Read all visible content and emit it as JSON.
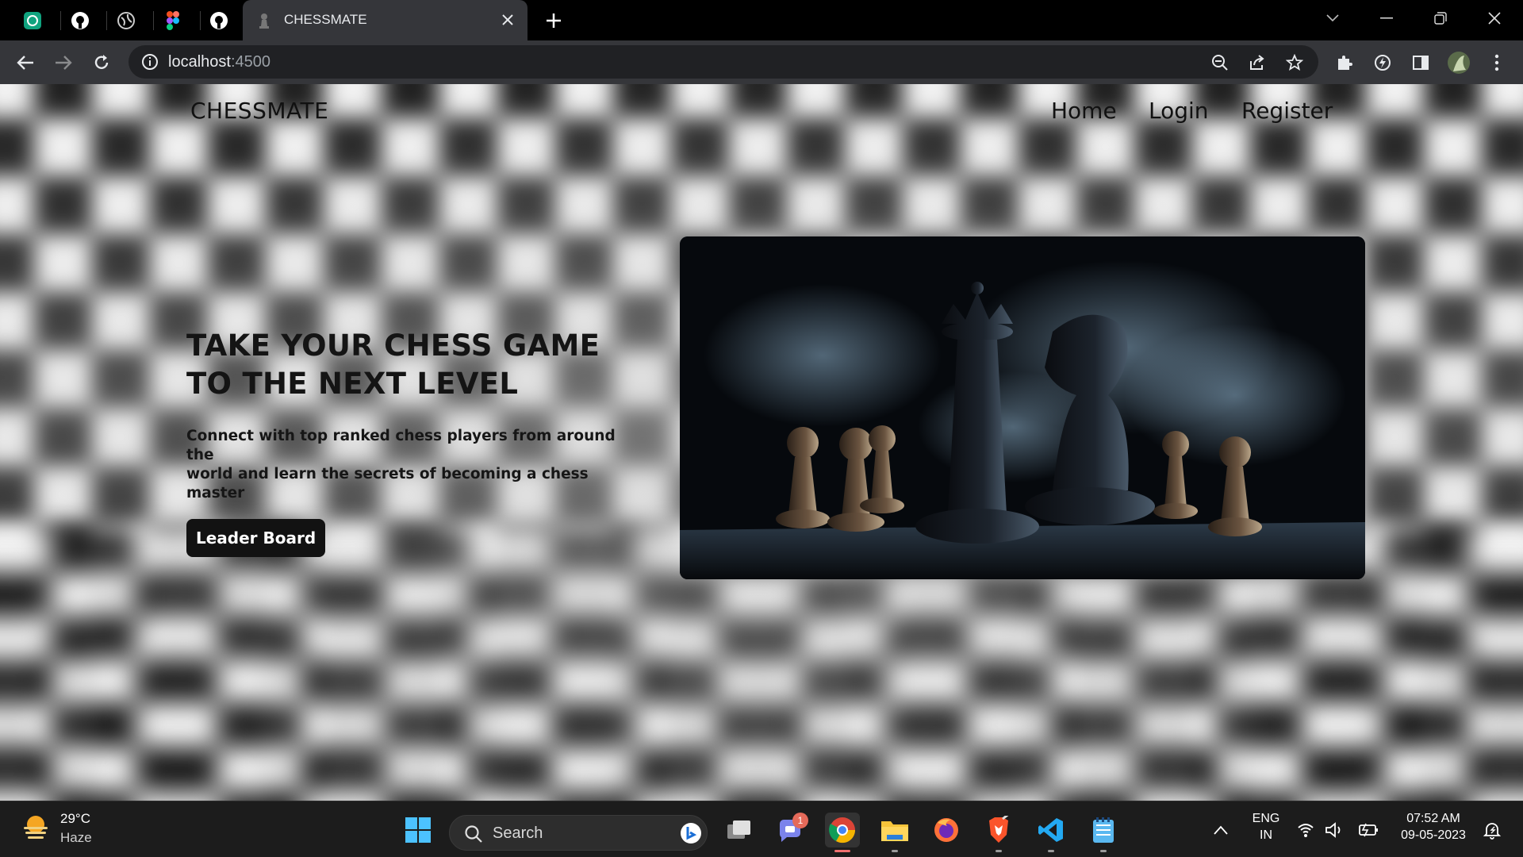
{
  "browser": {
    "tab_title": "CHESSMATE",
    "url_host": "localhost",
    "url_port": ":4500"
  },
  "site": {
    "brand": "CHESSMATE",
    "nav": [
      {
        "label": "Home"
      },
      {
        "label": "Login"
      },
      {
        "label": "Register"
      }
    ],
    "hero_title_line1": "TAKE YOUR CHESS GAME",
    "hero_title_line2": "TO THE NEXT LEVEL",
    "hero_sub_line1": "Connect with top ranked chess players from around the",
    "hero_sub_line2": "world and learn the secrets of becoming a chess master",
    "cta_label": "Leader Board"
  },
  "taskbar": {
    "weather_temp": "29°C",
    "weather_cond": "Haze",
    "search_placeholder": "Search",
    "teams_badge": "1",
    "lang_top": "ENG",
    "lang_bottom": "IN",
    "time": "07:52 AM",
    "date": "09-05-2023"
  },
  "colors": {
    "tab_active": "#35363a",
    "page_text": "#111111",
    "cta_bg": "#121212",
    "taskbar": "#1c1c1c"
  }
}
